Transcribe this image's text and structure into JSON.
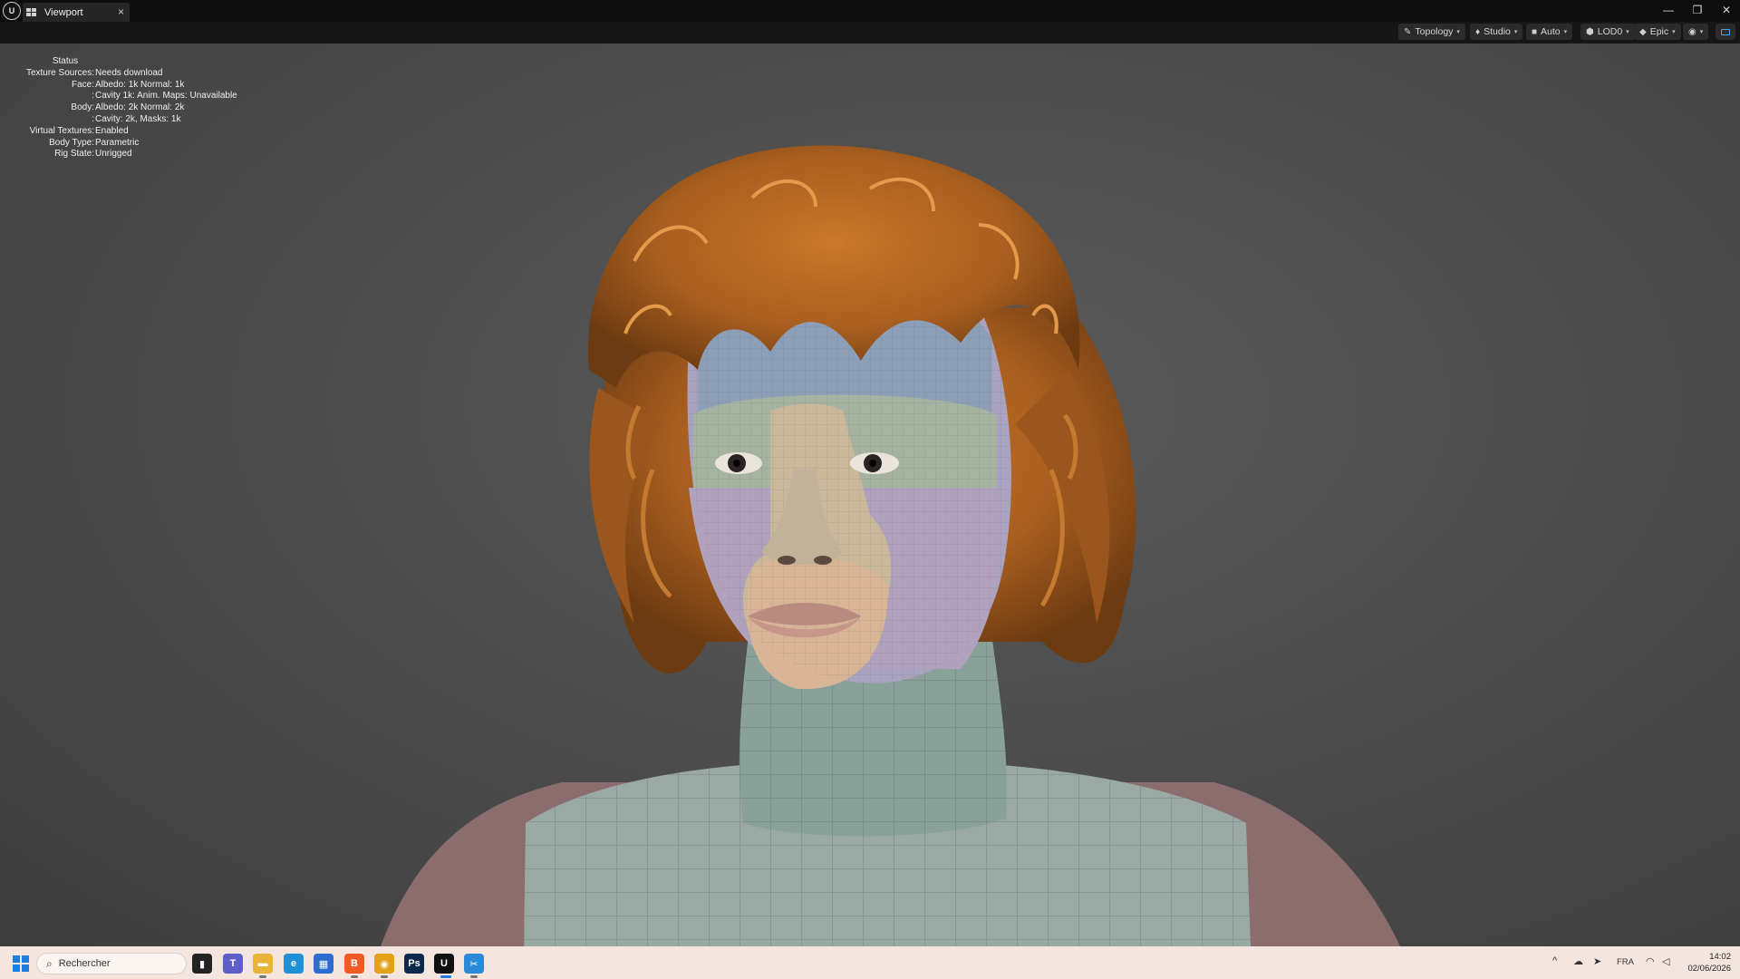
{
  "window": {
    "tab_label": "Viewport",
    "logo_text": "U",
    "tab_close": "×",
    "controls": {
      "minimize": "—",
      "restore": "❐",
      "close": "✕"
    }
  },
  "toolbar": {
    "buttons": [
      {
        "label": "Topology",
        "icon": "brush-icon"
      },
      {
        "label": "Studio",
        "icon": "light-icon"
      },
      {
        "label": "Auto",
        "icon": "camera-icon"
      },
      {
        "label": "LOD0",
        "icon": "lod-icon"
      },
      {
        "label": "Epic",
        "icon": "quality-icon"
      }
    ],
    "view_icon": "eye-icon",
    "caret": "▾"
  },
  "status": {
    "title": "Status",
    "rows": [
      {
        "key": "Texture Sources:",
        "value": "Needs download"
      },
      {
        "key": "Face:",
        "value": "Albedo: 1k Normal: 1k"
      },
      {
        "key": ":",
        "value": "Cavity 1k: Anim. Maps: Unavailable"
      },
      {
        "key": "Body:",
        "value": "Albedo: 2k Normal: 2k"
      },
      {
        "key": ":",
        "value": "Cavity: 2k, Masks: 1k"
      },
      {
        "key": "Virtual Textures:",
        "value": "Enabled"
      },
      {
        "key": "Body Type:",
        "value": "Parametric"
      },
      {
        "key": "Rig State:",
        "value": "Unrigged"
      }
    ]
  },
  "taskbar": {
    "search_placeholder": "Rechercher",
    "apps": [
      {
        "name": "terminal",
        "glyph": "▮",
        "color": "#222222"
      },
      {
        "name": "teams",
        "glyph": "T",
        "color": "#5b5fc7"
      },
      {
        "name": "explorer",
        "glyph": "▬",
        "color": "#e8b53a"
      },
      {
        "name": "edge",
        "glyph": "e",
        "color": "#1f8fd6"
      },
      {
        "name": "store",
        "glyph": "▦",
        "color": "#2c6bd1"
      },
      {
        "name": "brave",
        "glyph": "B",
        "color": "#f05a24"
      },
      {
        "name": "chrome",
        "glyph": "◉",
        "color": "#e3a21a"
      },
      {
        "name": "photoshop",
        "glyph": "Ps",
        "color": "#0b2a4a"
      },
      {
        "name": "unreal",
        "glyph": "U",
        "color": "#111111"
      },
      {
        "name": "snipping",
        "glyph": "✂",
        "color": "#2a8ad8"
      }
    ],
    "tray": {
      "chevron": "^",
      "lang": "FRA",
      "wifi": "wifi-icon",
      "volume": "volume-icon"
    },
    "time": "14:02",
    "date": "02/06/2026"
  }
}
